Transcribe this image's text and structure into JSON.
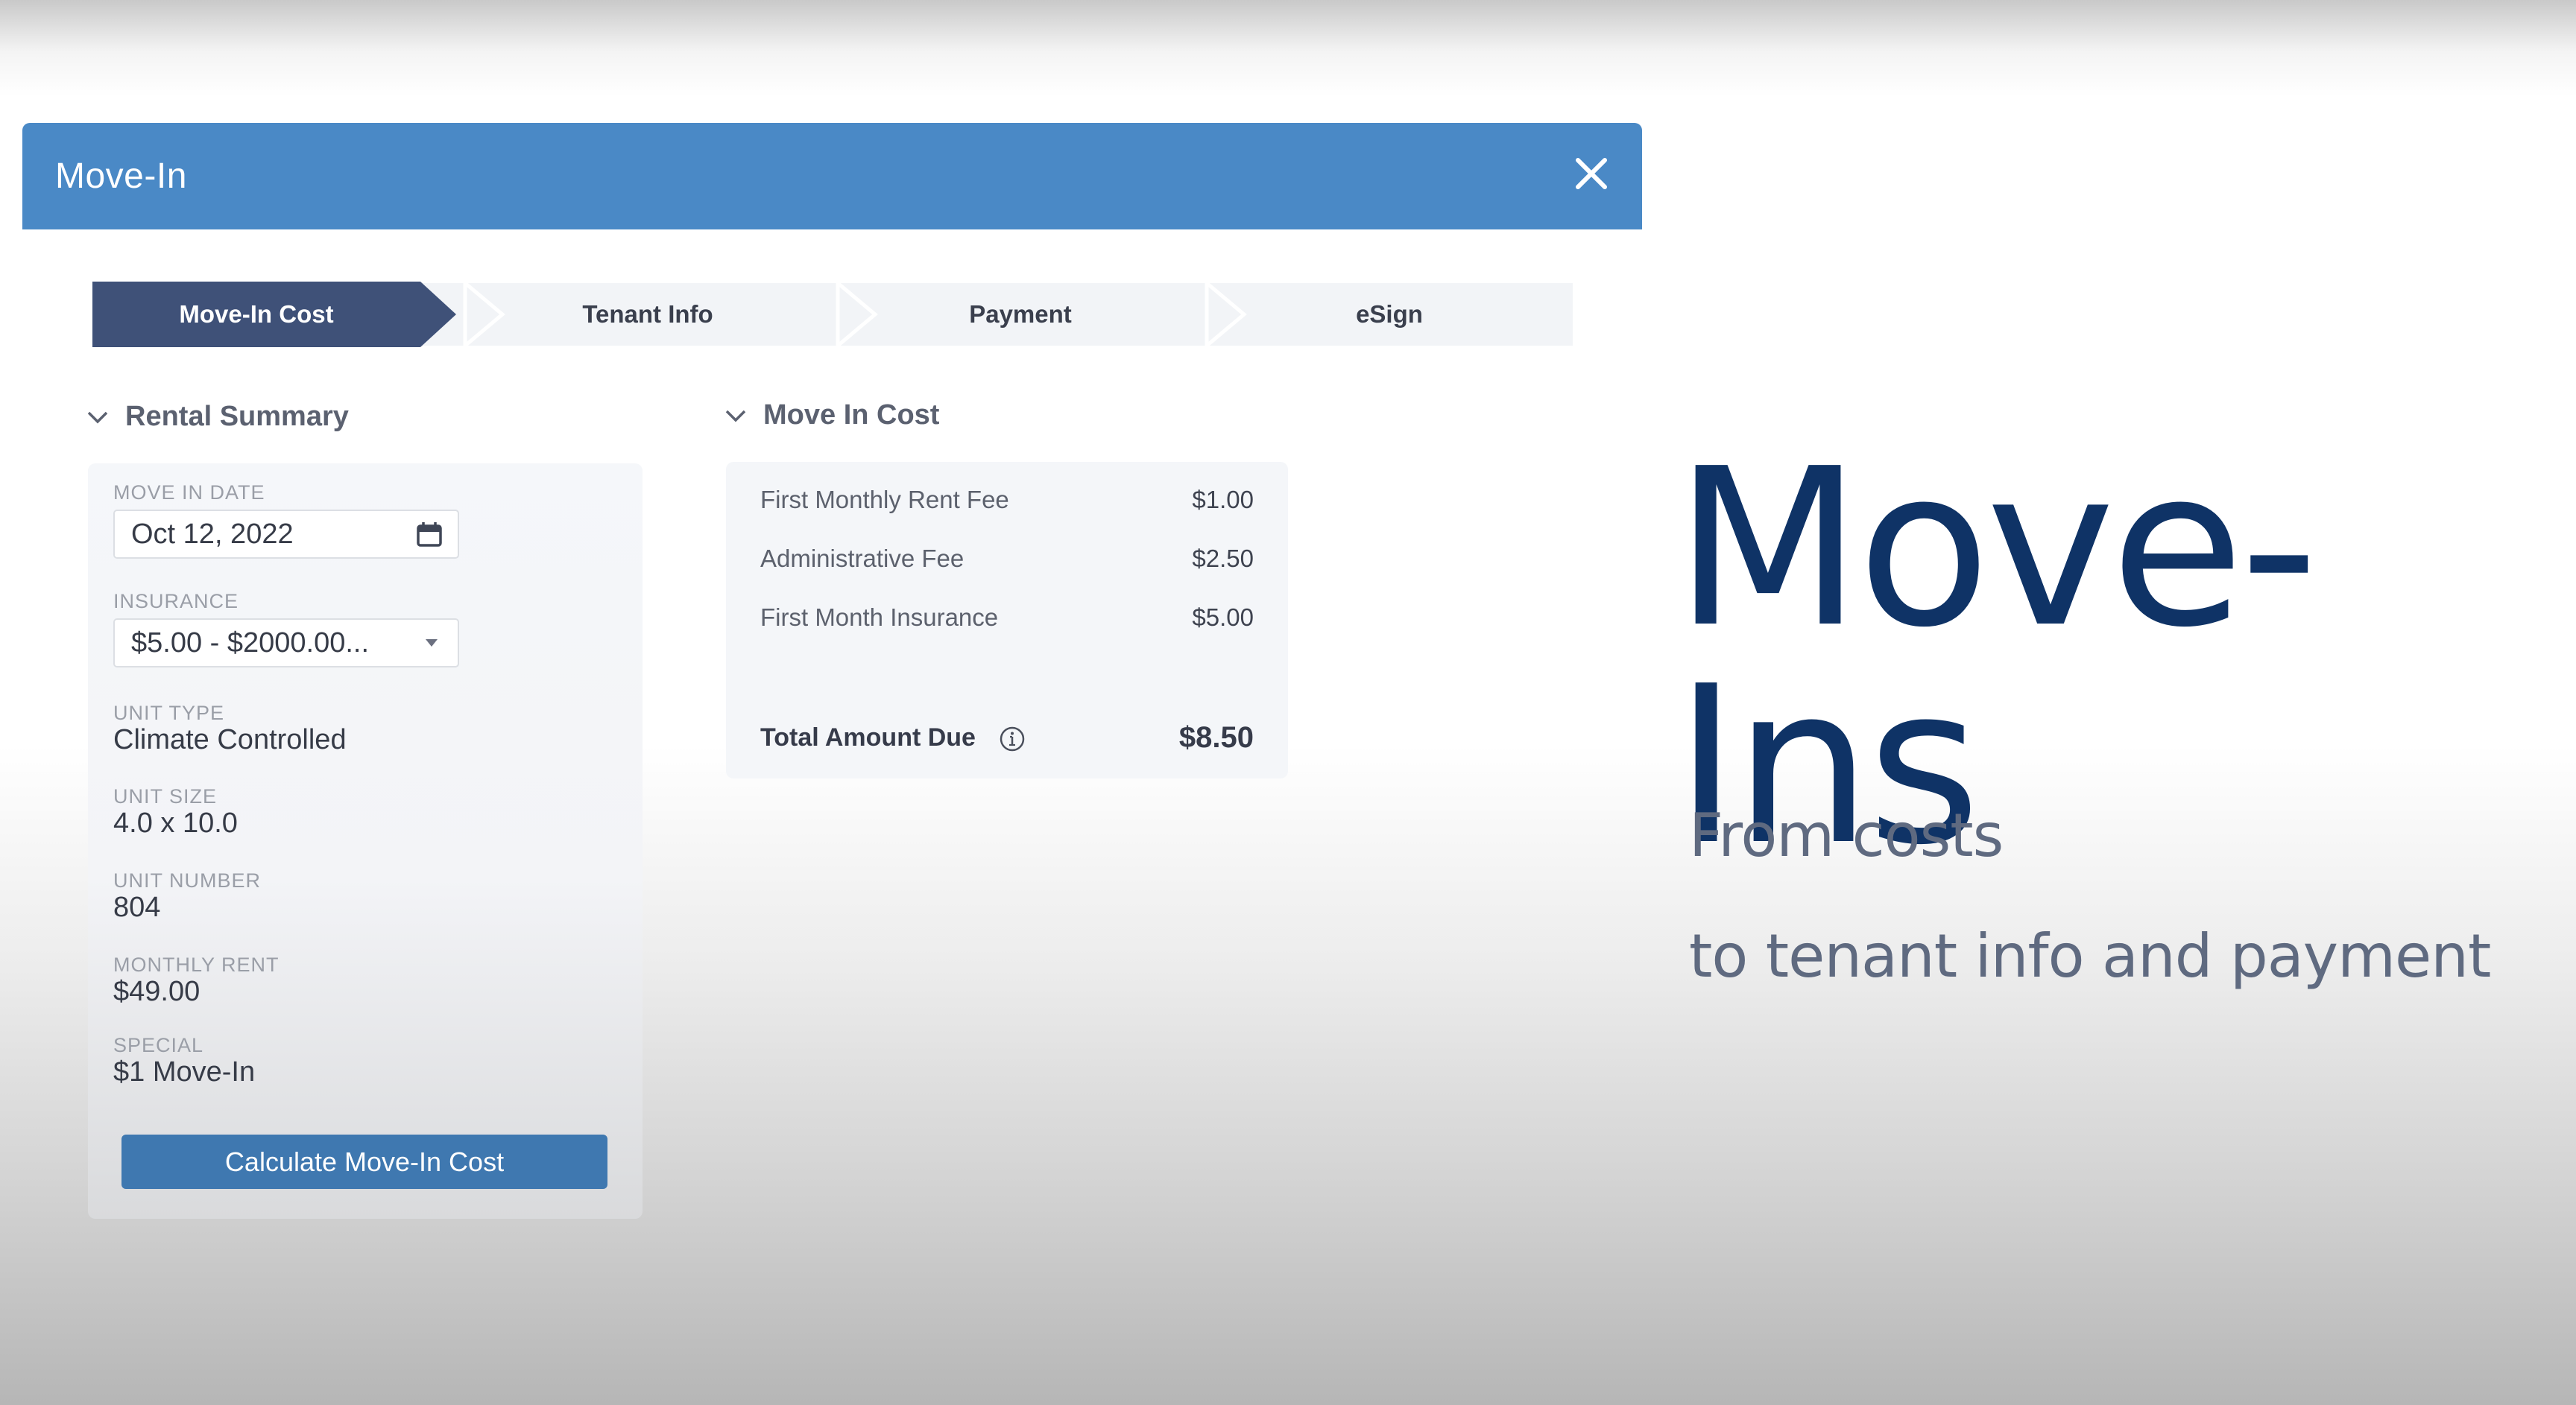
{
  "modal": {
    "title": "Move-In",
    "close_icon": "close-icon",
    "header_color": "#4a89c6"
  },
  "stepper": {
    "active_index": 0,
    "active_color": "#3f5178",
    "steps": [
      {
        "label": "Move-In Cost"
      },
      {
        "label": "Tenant Info"
      },
      {
        "label": "Payment"
      },
      {
        "label": "eSign"
      }
    ]
  },
  "rental_summary": {
    "heading": "Rental Summary",
    "move_in_date": {
      "label": "MOVE IN DATE",
      "value": "Oct 12, 2022",
      "icon": "calendar-icon"
    },
    "insurance": {
      "label": "INSURANCE",
      "value": "$5.00 - $2000.00...",
      "icon": "dropdown-caret-icon"
    },
    "unit_type": {
      "label": "UNIT TYPE",
      "value": "Climate Controlled"
    },
    "unit_size": {
      "label": "UNIT SIZE",
      "value": "4.0 x 10.0"
    },
    "unit_number": {
      "label": "UNIT NUMBER",
      "value": "804"
    },
    "monthly_rent": {
      "label": "MONTHLY RENT",
      "value": "$49.00"
    },
    "special": {
      "label": "SPECIAL",
      "value": "$1 Move-In"
    },
    "calculate_button": "Calculate Move-In Cost",
    "button_color": "#3f78b0"
  },
  "move_in_cost": {
    "heading": "Move In Cost",
    "items": [
      {
        "label": "First Monthly Rent Fee",
        "amount": "$1.00"
      },
      {
        "label": "Administrative Fee",
        "amount": "$2.50"
      },
      {
        "label": "First Month Insurance",
        "amount": "$5.00"
      }
    ],
    "total": {
      "label": "Total Amount Due",
      "amount": "$8.50",
      "icon": "info-icon"
    }
  },
  "slide": {
    "title": "Move-Ins",
    "subtitle_line1": "From costs",
    "subtitle_line2": "to tenant info and payment",
    "title_color": "#0f3366",
    "subtitle_color": "#5f6a80"
  }
}
